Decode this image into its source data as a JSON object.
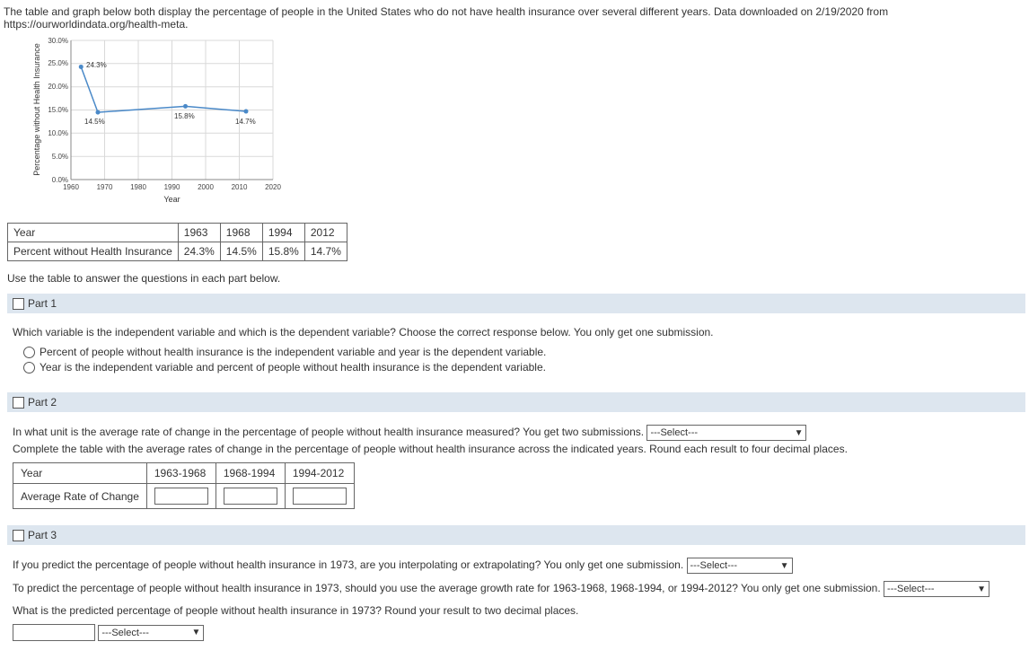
{
  "intro": "The table and graph below both display the percentage of people in the United States who do not have health insurance over several different years. Data downloaded on 2/19/2020 from https://ourworldindata.org/health-meta.",
  "chart_data": {
    "type": "line",
    "title": "",
    "xlabel": "Year",
    "ylabel": "Percentage without Health Insurance",
    "xlim": [
      1960,
      2020
    ],
    "ylim": [
      0,
      30
    ],
    "x_ticks": [
      "1960",
      "1970",
      "1980",
      "1990",
      "2000",
      "2010",
      "2020"
    ],
    "y_ticks": [
      "0.0%",
      "5.0%",
      "10.0%",
      "15.0%",
      "20.0%",
      "25.0%",
      "30.0%"
    ],
    "x": [
      1963,
      1968,
      1994,
      2012
    ],
    "values": [
      24.3,
      14.5,
      15.8,
      14.7
    ],
    "point_labels": [
      "24.3%",
      "14.5%",
      "15.8%",
      "14.7%"
    ]
  },
  "table": {
    "row_labels": [
      "Year",
      "Percent without Health Insurance"
    ],
    "cols": [
      {
        "year": "1963",
        "pct": "24.3%"
      },
      {
        "year": "1968",
        "pct": "14.5%"
      },
      {
        "year": "1994",
        "pct": "15.8%"
      },
      {
        "year": "2012",
        "pct": "14.7%"
      }
    ]
  },
  "instruction": "Use the table to answer the questions in each part below.",
  "part1": {
    "title": "Part 1",
    "prompt": "Which variable is the independent variable and which is the dependent variable? Choose the correct response below. You only get one submission.",
    "opt_a": "Percent of people without health insurance is the independent variable and year is the dependent variable.",
    "opt_b": "Year is the independent variable and percent of people without health insurance is the dependent variable."
  },
  "part2": {
    "title": "Part 2",
    "q1_pre": "In what unit is the average rate of change in the percentage of people without health insurance measured? You get two submissions.",
    "q2": "Complete the table with the average rates of change in the percentage of people without health insurance across the indicated years. Round each result to four decimal places.",
    "roc_headers": [
      "Year",
      "1963-1968",
      "1968-1994",
      "1994-2012"
    ],
    "roc_row_label": "Average Rate of Change"
  },
  "part3": {
    "title": "Part 3",
    "q1": "If you predict the percentage of people without health insurance in 1973, are you interpolating or extrapolating? You only get one submission.",
    "q2": "To predict the percentage of people without health insurance in 1973, should you use the average growth rate for 1963-1968, 1968-1994, or 1994-2012? You only get one submission.",
    "q3": "What is the predicted percentage of people without health insurance in 1973? Round your result to two decimal places."
  },
  "select_placeholder": "---Select---"
}
